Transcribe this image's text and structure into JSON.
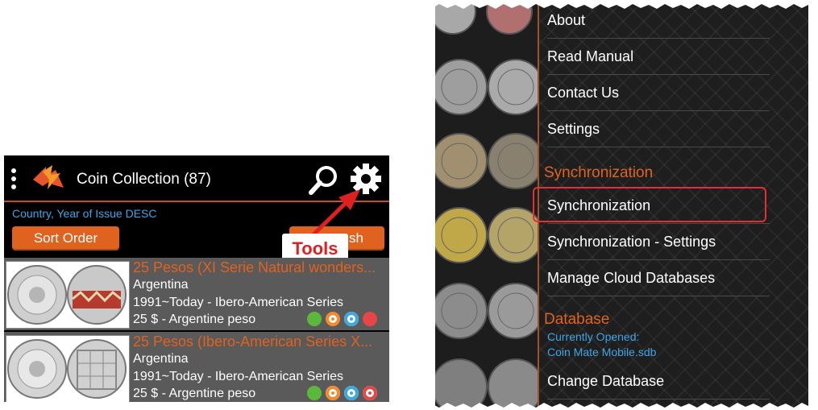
{
  "left": {
    "app_title": "Coin Collection (87)",
    "sort_description": "Country, Year of Issue DESC",
    "sort_button": "Sort Order",
    "refresh_button_partial": "sh",
    "annotation": "Tools",
    "icons": [
      "kebab-menu-icon",
      "app-logo-icon",
      "search-icon",
      "gear-icon"
    ],
    "rows": [
      {
        "title": "25 Pesos (XI Serie Natural wonders...",
        "country": "Argentina",
        "series": "1991~Today - Ibero-American Series",
        "value": "25 $ - Argentine peso",
        "dots": [
          "#5cb83a",
          "#f58a2c",
          "#3aa9e0",
          "#e64646"
        ]
      },
      {
        "title": "25 Pesos (Ibero-American Series X...",
        "country": "Argentina",
        "series": "1991~Today - Ibero-American Series",
        "value": "25 $ - Argentine peso",
        "dots": [
          "#5cb83a",
          "#f58a2c",
          "#3aa9e0",
          "#e64646"
        ]
      }
    ]
  },
  "right": {
    "menu_top": [
      "About",
      "Read Manual",
      "Contact Us",
      "Settings"
    ],
    "sync_header": "Synchronization",
    "sync_items": [
      "Synchronization",
      "Synchronization - Settings",
      "Manage Cloud Databases"
    ],
    "db_header": "Database",
    "db_currently_opened": "Currently Opened:",
    "db_name": "Coin Mate Mobile.sdb",
    "db_items": [
      "Change Database"
    ]
  },
  "colors": {
    "accent": "#e0621f",
    "link": "#3fa5e6",
    "highlight": "#e53030",
    "annotation": "#e02020"
  }
}
